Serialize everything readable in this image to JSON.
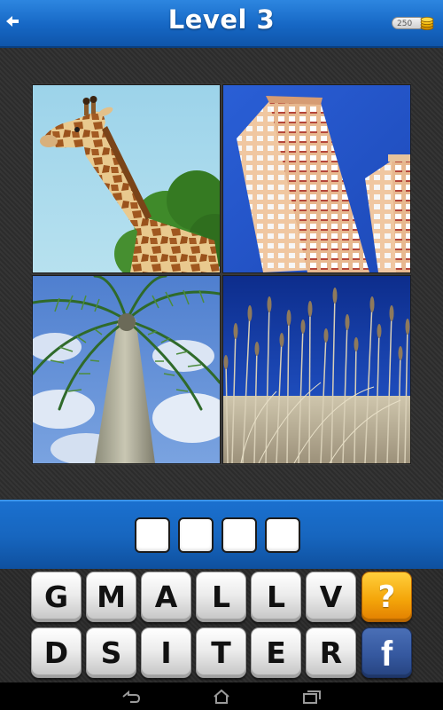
{
  "header": {
    "title": "Level 3",
    "coins": "250",
    "back_icon": "back-arrow-icon",
    "coin_icon": "coin-stack-icon"
  },
  "pictures": [
    {
      "name": "giraffe"
    },
    {
      "name": "tower"
    },
    {
      "name": "palm"
    },
    {
      "name": "reeds"
    }
  ],
  "answer": {
    "slots": [
      "",
      "",
      "",
      ""
    ]
  },
  "keyboard": {
    "row1": [
      "G",
      "M",
      "A",
      "L",
      "L",
      "V"
    ],
    "row2": [
      "D",
      "S",
      "I",
      "T",
      "E",
      "R"
    ],
    "hint_label": "?",
    "facebook_label": "f"
  },
  "navbar": {
    "icons": [
      "back-icon",
      "home-icon",
      "recent-apps-icon"
    ]
  },
  "colors": {
    "header_blue": "#1667c4",
    "hint_orange": "#f4a60a",
    "facebook_blue": "#35589f"
  }
}
